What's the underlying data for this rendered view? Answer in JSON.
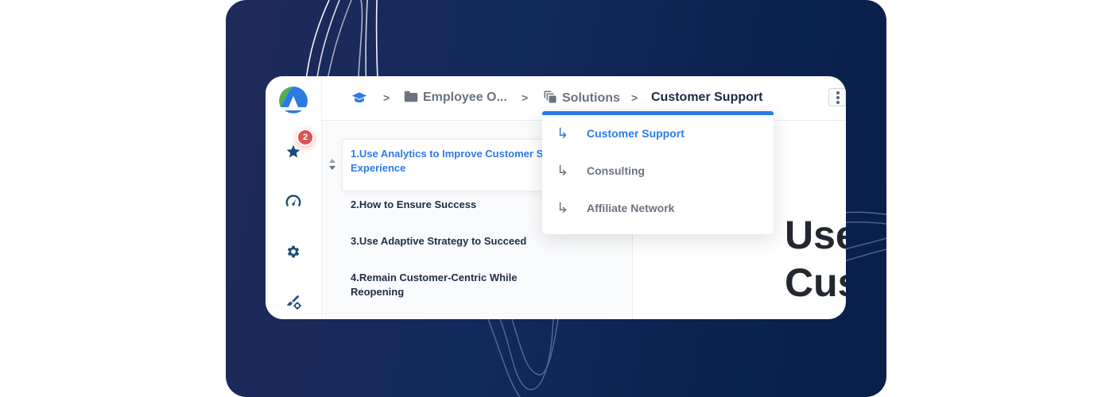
{
  "colors": {
    "accent": "#2c7be5",
    "text_dark": "#1f2d45",
    "text_muted": "#6b7380",
    "badge": "#e05252",
    "background_navy": "#0b2250"
  },
  "sidebar": {
    "logo": "app-logo",
    "items": [
      {
        "icon": "star-icon",
        "badge": "2"
      },
      {
        "icon": "speedometer-icon"
      },
      {
        "icon": "gear-icon"
      },
      {
        "icon": "brush-settings-icon"
      }
    ]
  },
  "breadcrumb": {
    "items": [
      {
        "icon": "graduation-cap-icon",
        "label": ""
      },
      {
        "icon": "folder-icon",
        "label": "Employee O..."
      },
      {
        "icon": "copy-pages-icon",
        "label": "Solutions"
      },
      {
        "icon": "",
        "label": "Customer Support"
      }
    ],
    "separator": ">"
  },
  "dropdown": {
    "items": [
      {
        "label": "Customer Support",
        "active": true
      },
      {
        "label": "Consulting",
        "active": false
      },
      {
        "label": "Affiliate Network",
        "active": false
      }
    ],
    "arrow_glyph": "↳"
  },
  "outline": {
    "items": [
      {
        "label": "1.Use Analytics to Improve Customer S",
        "label_line2": "Experience",
        "active": true
      },
      {
        "label": "2.How to Ensure Success"
      },
      {
        "label": "3.Use Adaptive Strategy to Succeed"
      },
      {
        "label": "4.Remain Customer-Centric While",
        "label_line2": "Reopening"
      }
    ]
  },
  "main": {
    "title_line1": "Use",
    "title_line2": "Cus"
  }
}
